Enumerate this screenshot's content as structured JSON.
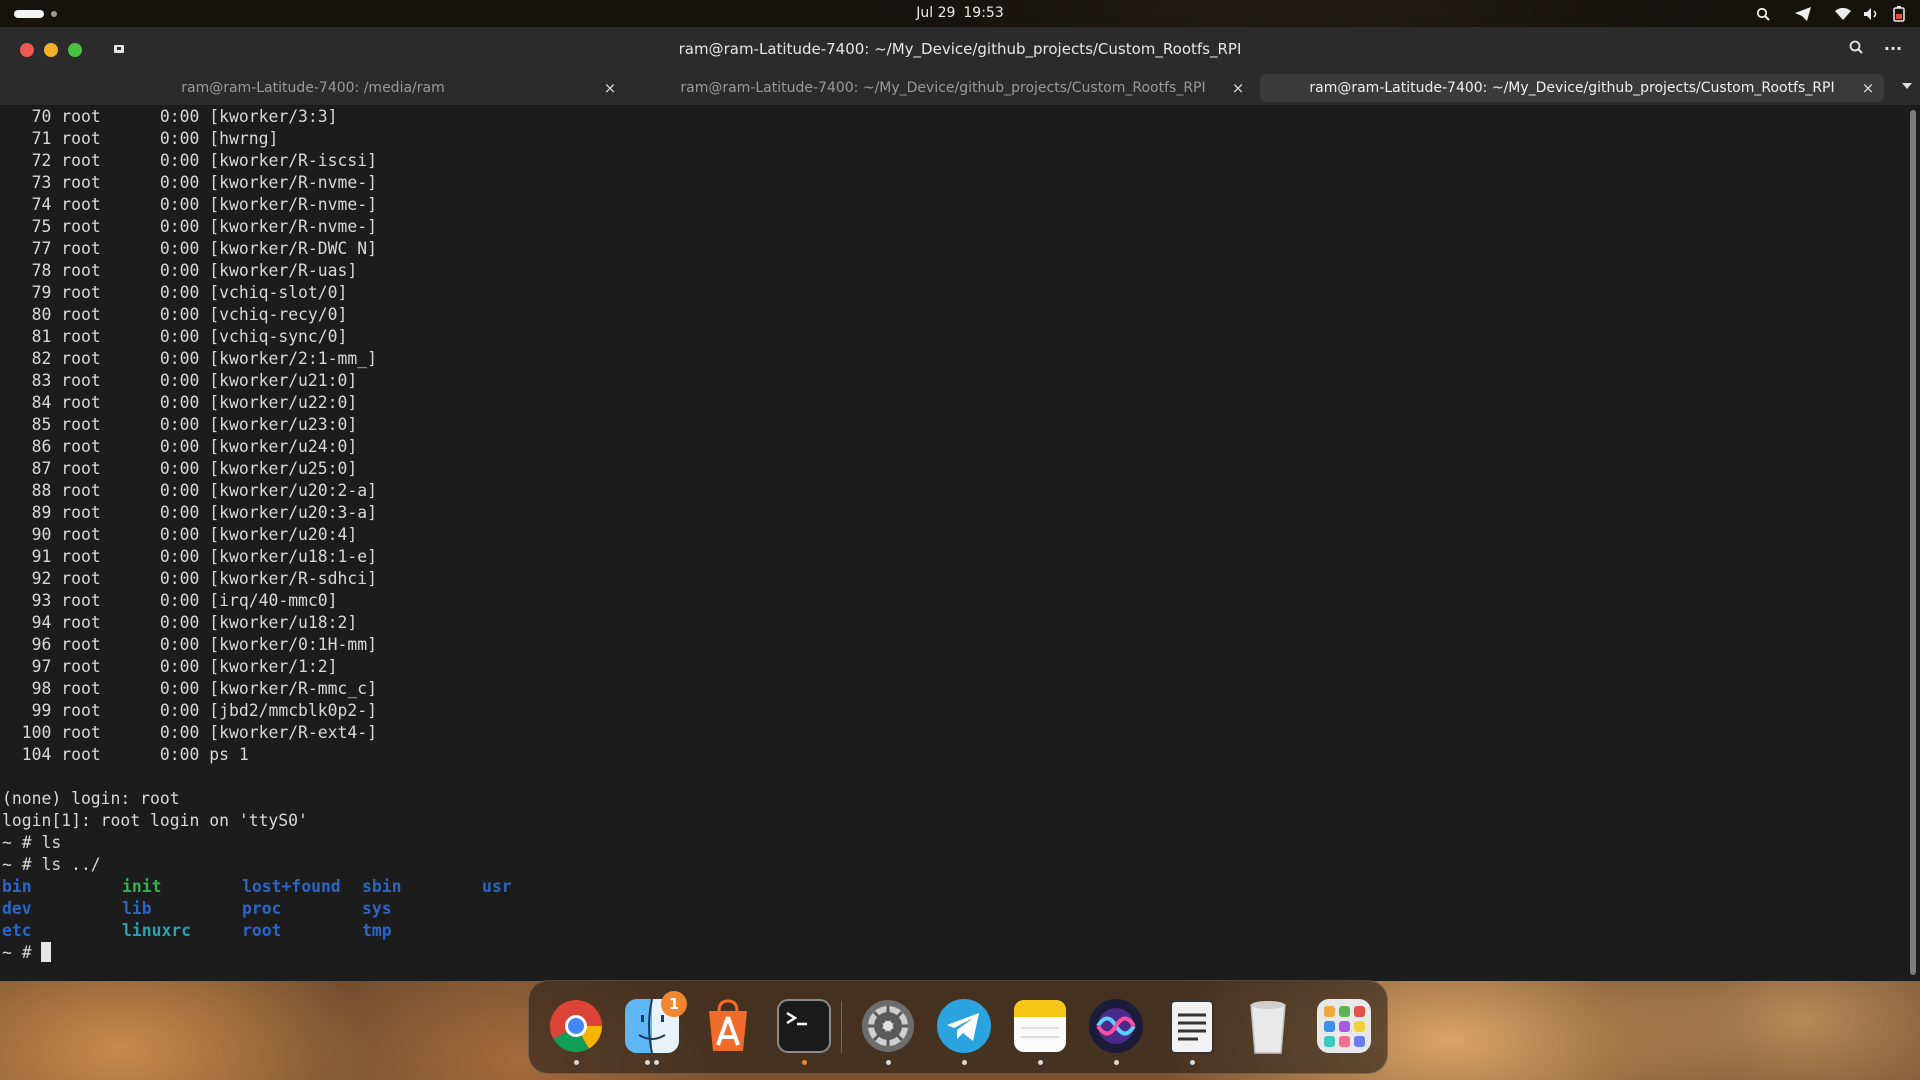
{
  "topbar": {
    "date": "Jul 29",
    "time": "19:53"
  },
  "window": {
    "title": "ram@ram-Latitude-7400: ~/My_Device/github_projects/Custom_Rootfs_RPI",
    "tabs": [
      {
        "label": "ram@ram-Latitude-7400: /media/ram",
        "close": "×",
        "active": false
      },
      {
        "label": "ram@ram-Latitude-7400: ~/My_Device/github_projects/Custom_Rootfs_RPI",
        "close": "×",
        "active": false
      },
      {
        "label": "ram@ram-Latitude-7400: ~/My_Device/github_projects/Custom_Rootfs_RPI",
        "close": "×",
        "active": true
      }
    ]
  },
  "terminal": {
    "processes": [
      {
        "pid": "70",
        "user": "root",
        "time": "0:00",
        "cmd": "[kworker/3:3]"
      },
      {
        "pid": "71",
        "user": "root",
        "time": "0:00",
        "cmd": "[hwrng]"
      },
      {
        "pid": "72",
        "user": "root",
        "time": "0:00",
        "cmd": "[kworker/R-iscsi]"
      },
      {
        "pid": "73",
        "user": "root",
        "time": "0:00",
        "cmd": "[kworker/R-nvme-]"
      },
      {
        "pid": "74",
        "user": "root",
        "time": "0:00",
        "cmd": "[kworker/R-nvme-]"
      },
      {
        "pid": "75",
        "user": "root",
        "time": "0:00",
        "cmd": "[kworker/R-nvme-]"
      },
      {
        "pid": "77",
        "user": "root",
        "time": "0:00",
        "cmd": "[kworker/R-DWC N]"
      },
      {
        "pid": "78",
        "user": "root",
        "time": "0:00",
        "cmd": "[kworker/R-uas]"
      },
      {
        "pid": "79",
        "user": "root",
        "time": "0:00",
        "cmd": "[vchiq-slot/0]"
      },
      {
        "pid": "80",
        "user": "root",
        "time": "0:00",
        "cmd": "[vchiq-recy/0]"
      },
      {
        "pid": "81",
        "user": "root",
        "time": "0:00",
        "cmd": "[vchiq-sync/0]"
      },
      {
        "pid": "82",
        "user": "root",
        "time": "0:00",
        "cmd": "[kworker/2:1-mm_]"
      },
      {
        "pid": "83",
        "user": "root",
        "time": "0:00",
        "cmd": "[kworker/u21:0]"
      },
      {
        "pid": "84",
        "user": "root",
        "time": "0:00",
        "cmd": "[kworker/u22:0]"
      },
      {
        "pid": "85",
        "user": "root",
        "time": "0:00",
        "cmd": "[kworker/u23:0]"
      },
      {
        "pid": "86",
        "user": "root",
        "time": "0:00",
        "cmd": "[kworker/u24:0]"
      },
      {
        "pid": "87",
        "user": "root",
        "time": "0:00",
        "cmd": "[kworker/u25:0]"
      },
      {
        "pid": "88",
        "user": "root",
        "time": "0:00",
        "cmd": "[kworker/u20:2-a]"
      },
      {
        "pid": "89",
        "user": "root",
        "time": "0:00",
        "cmd": "[kworker/u20:3-a]"
      },
      {
        "pid": "90",
        "user": "root",
        "time": "0:00",
        "cmd": "[kworker/u20:4]"
      },
      {
        "pid": "91",
        "user": "root",
        "time": "0:00",
        "cmd": "[kworker/u18:1-e]"
      },
      {
        "pid": "92",
        "user": "root",
        "time": "0:00",
        "cmd": "[kworker/R-sdhci]"
      },
      {
        "pid": "93",
        "user": "root",
        "time": "0:00",
        "cmd": "[irq/40-mmc0]"
      },
      {
        "pid": "94",
        "user": "root",
        "time": "0:00",
        "cmd": "[kworker/u18:2]"
      },
      {
        "pid": "96",
        "user": "root",
        "time": "0:00",
        "cmd": "[kworker/0:1H-mm]"
      },
      {
        "pid": "97",
        "user": "root",
        "time": "0:00",
        "cmd": "[kworker/1:2]"
      },
      {
        "pid": "98",
        "user": "root",
        "time": "0:00",
        "cmd": "[kworker/R-mmc_c]"
      },
      {
        "pid": "99",
        "user": "root",
        "time": "0:00",
        "cmd": "[jbd2/mmcblk0p2-]"
      },
      {
        "pid": "100",
        "user": "root",
        "time": "0:00",
        "cmd": "[kworker/R-ext4-]"
      },
      {
        "pid": "104",
        "user": "root",
        "time": "0:00",
        "cmd": "ps 1"
      }
    ],
    "lines_after": [
      "",
      "(none) login: root",
      "login[1]: root login on 'ttyS0'",
      "~ # ls",
      "~ # ls ../"
    ],
    "ls_rows": [
      [
        {
          "name": "bin",
          "kind": "dir"
        },
        {
          "name": "init",
          "kind": "exe"
        },
        {
          "name": "lost+found",
          "kind": "dir"
        },
        {
          "name": "sbin",
          "kind": "dir"
        },
        {
          "name": "usr",
          "kind": "dir"
        }
      ],
      [
        {
          "name": "dev",
          "kind": "dir"
        },
        {
          "name": "lib",
          "kind": "dir"
        },
        {
          "name": "proc",
          "kind": "dir"
        },
        {
          "name": "sys",
          "kind": "dir"
        }
      ],
      [
        {
          "name": "etc",
          "kind": "dir"
        },
        {
          "name": "linuxrc",
          "kind": "link"
        },
        {
          "name": "root",
          "kind": "dir"
        },
        {
          "name": "tmp",
          "kind": "dir"
        }
      ]
    ],
    "prompt": "~ # "
  },
  "dock": {
    "apps": [
      {
        "name": "chrome-icon"
      },
      {
        "name": "finder-icon",
        "badge": "1"
      },
      {
        "name": "app-store-icon"
      },
      {
        "name": "terminal-icon"
      },
      {
        "name": "system-settings-icon"
      },
      {
        "name": "telegram-icon"
      },
      {
        "name": "notes-icon"
      },
      {
        "name": "siri-icon"
      },
      {
        "name": "text-editor-icon"
      },
      {
        "name": "trash-icon"
      },
      {
        "name": "launchpad-icon"
      }
    ]
  },
  "colors": {
    "dir": "#2a66c9",
    "exe": "#2fb24f",
    "link": "#2aa1b3",
    "terminal_bg": "#1c1c1c"
  }
}
